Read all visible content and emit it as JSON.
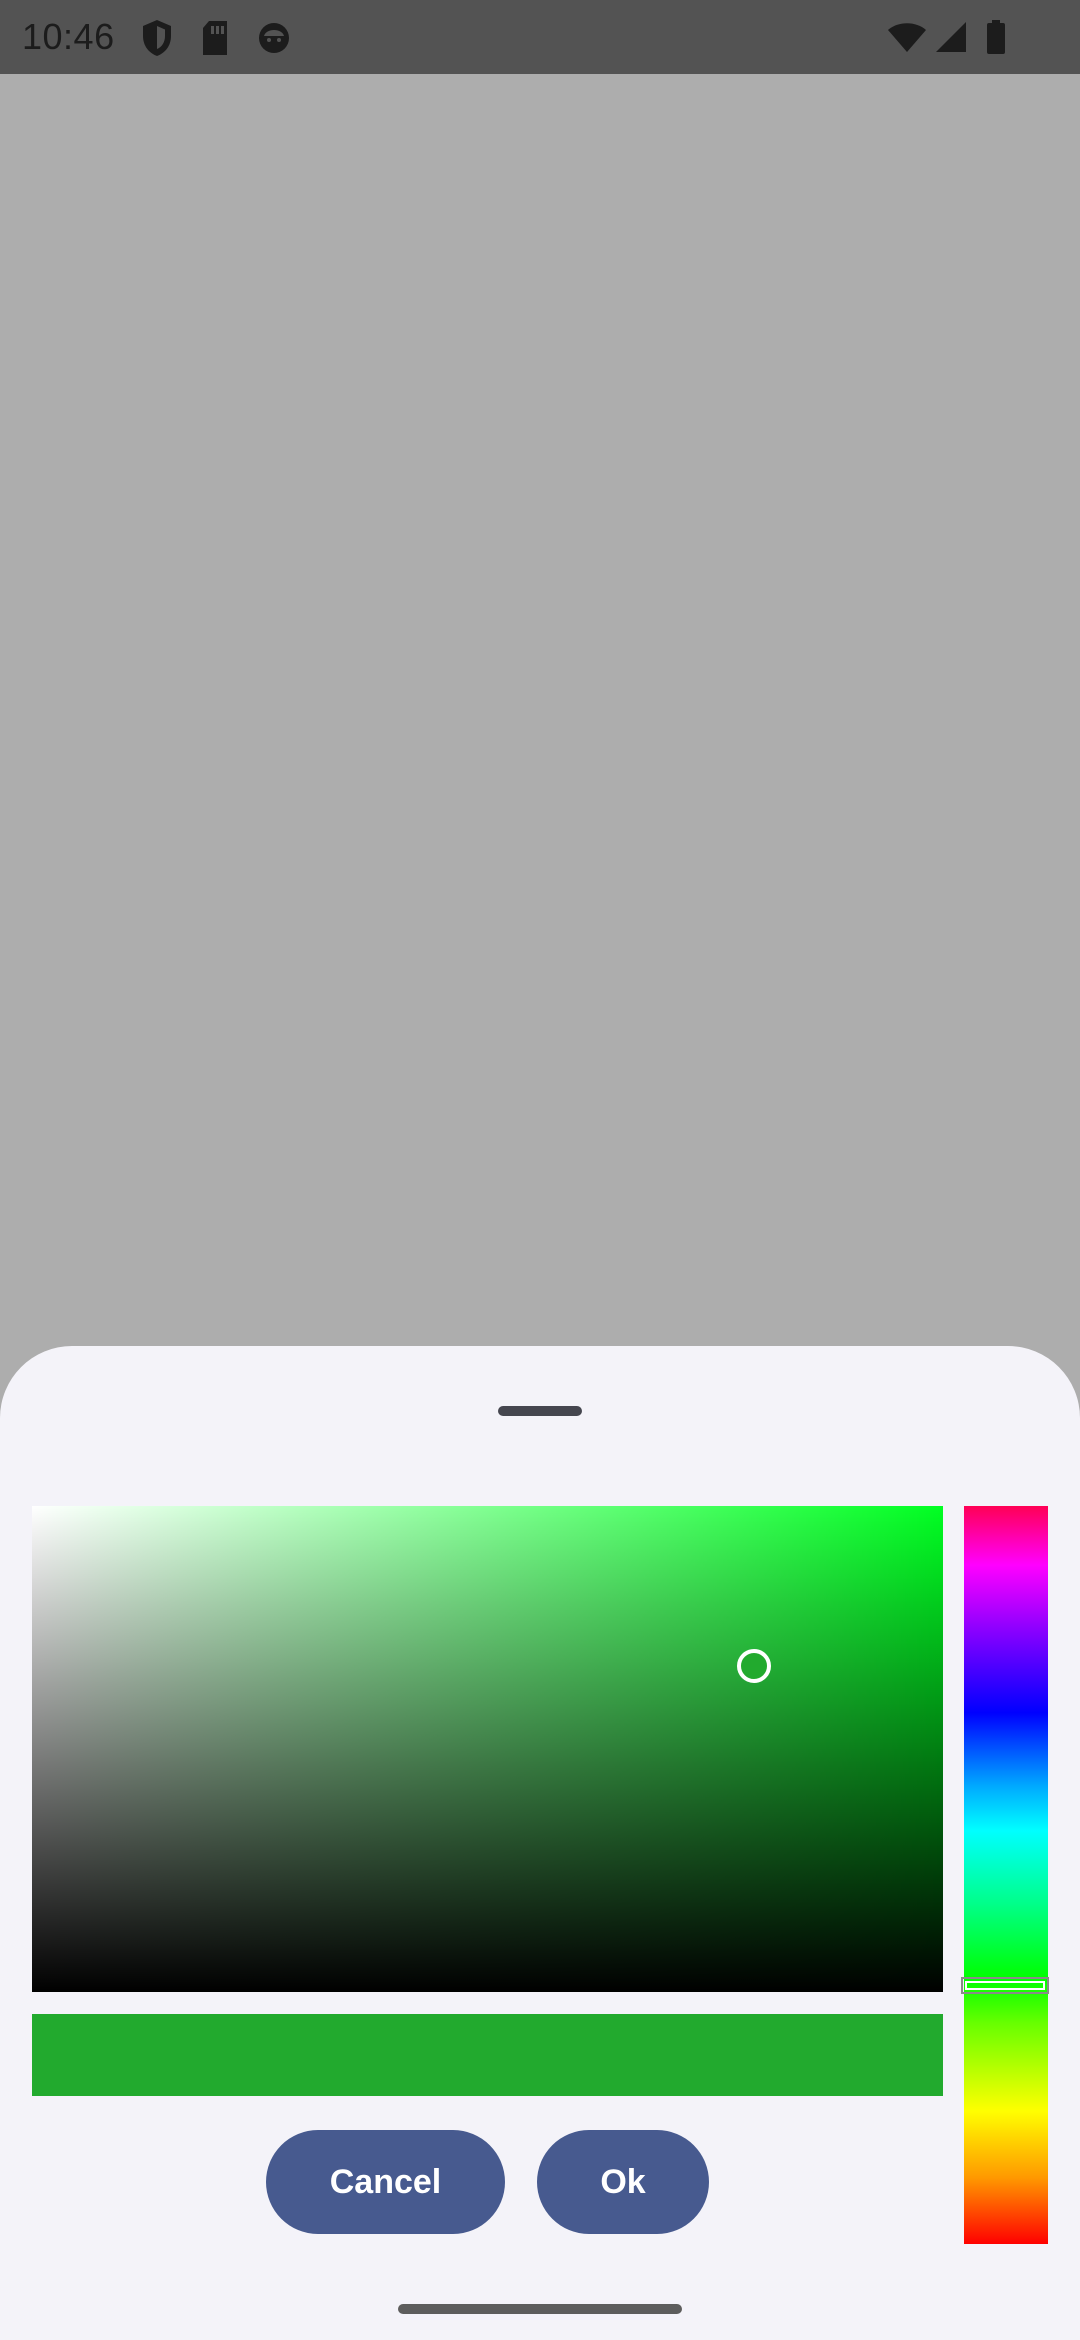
{
  "status_bar": {
    "time": "10:46",
    "left_icons": [
      "shield-icon",
      "sd-card-icon",
      "face-icon"
    ],
    "right_icons": [
      "wifi-icon",
      "signal-icon",
      "battery-icon"
    ]
  },
  "color_picker": {
    "selected_color": "#22aa2e",
    "hue_color": "#00ff22",
    "saturation": 0.77,
    "brightness": 0.67,
    "hue_position": 0.64
  },
  "actions": {
    "cancel_label": "Cancel",
    "ok_label": "Ok"
  },
  "colors": {
    "button_bg": "#475a8f",
    "sheet_bg": "#f4f3f9",
    "scrim": "#adadad"
  }
}
